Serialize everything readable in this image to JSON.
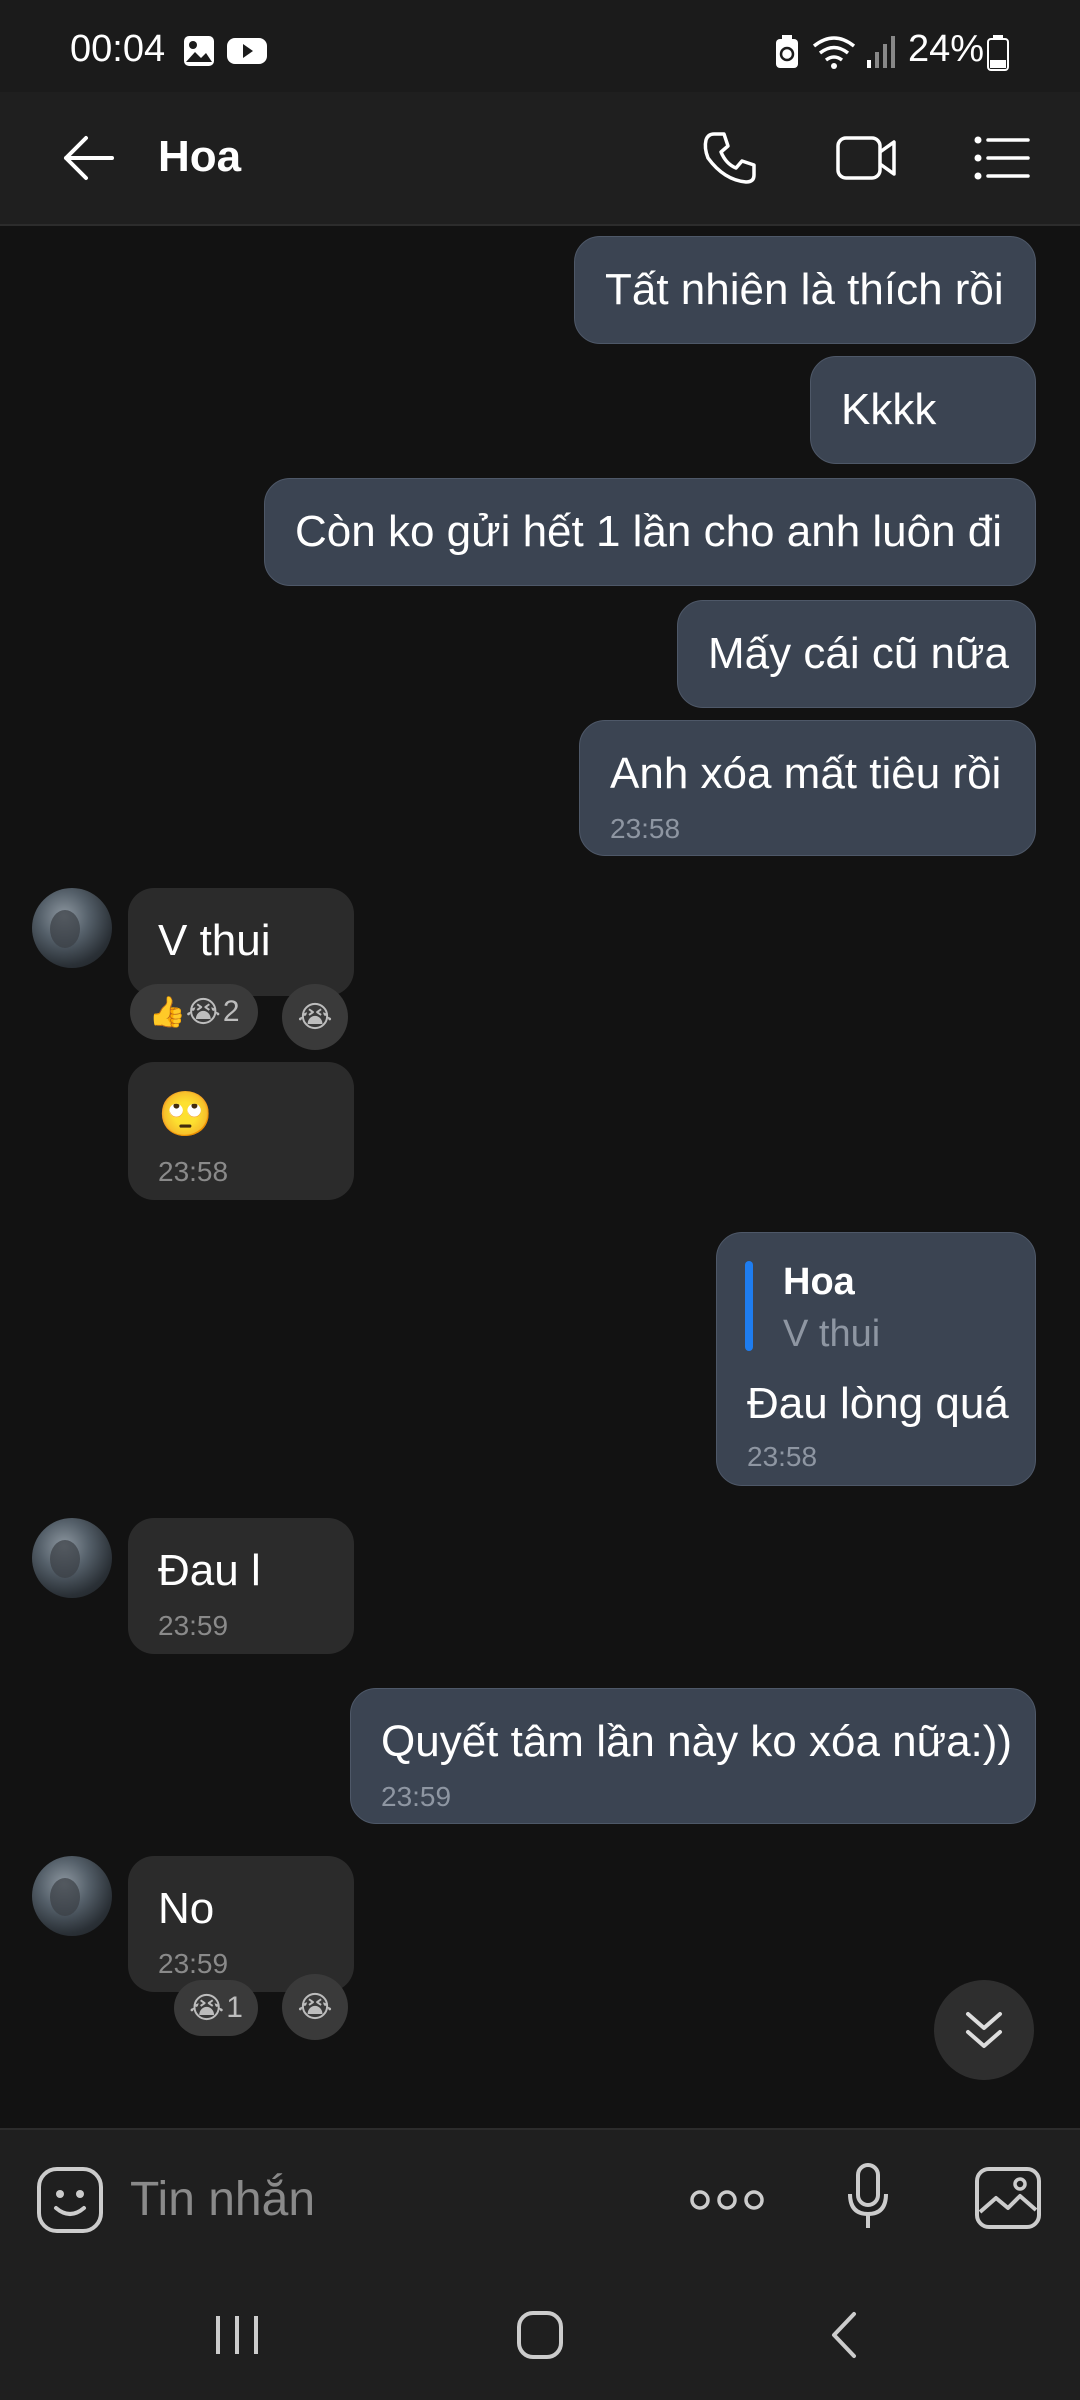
{
  "status_bar": {
    "time": "00:04",
    "battery": "24%",
    "icons": [
      "gallery-icon",
      "youtube-icon",
      "battery-saver-icon",
      "wifi-icon",
      "signal-icon",
      "battery-icon"
    ]
  },
  "header": {
    "contact_name": "Hoa",
    "icons": [
      "back-arrow-icon",
      "phone-icon",
      "video-call-icon",
      "menu-list-icon"
    ]
  },
  "messages": {
    "m1": {
      "text": "Tất nhiên là thích rồi"
    },
    "m2": {
      "text": "Kkkk"
    },
    "m3": {
      "text": "Còn ko gửi hết 1 lần cho anh luôn đi"
    },
    "m4": {
      "text": "Mấy cái cũ nữa"
    },
    "m5": {
      "text": "Anh xóa mất tiêu rồi",
      "time": "23:58"
    },
    "m6": {
      "text": "V thui",
      "reaction_emojis": "👍😭",
      "reaction_count": "2",
      "add_reaction": "😭"
    },
    "m7": {
      "text": "🙄",
      "time": "23:58"
    },
    "m8": {
      "reply_name": "Hoa",
      "reply_text": "V thui",
      "text": "Đau lòng quá",
      "time": "23:58"
    },
    "m9": {
      "text": "Đau l",
      "time": "23:59"
    },
    "m10": {
      "text": "Quyết tâm lần này ko xóa nữa:))",
      "time": "23:59"
    },
    "m11": {
      "text": "No",
      "time": "23:59",
      "reaction_emojis": "😭",
      "reaction_count": "1",
      "add_reaction": "😭"
    }
  },
  "input": {
    "placeholder": "Tin nhắn",
    "icons": [
      "sticker-icon",
      "more-options-icon",
      "microphone-icon",
      "gallery-icon"
    ]
  },
  "nav": {
    "icons": [
      "recent-apps-icon",
      "home-icon",
      "back-icon"
    ]
  },
  "colors": {
    "background": "#121212",
    "outgoing_bubble": "#3b4452",
    "incoming_bubble": "#2b2b2b",
    "reply_accent": "#1e7df0"
  }
}
